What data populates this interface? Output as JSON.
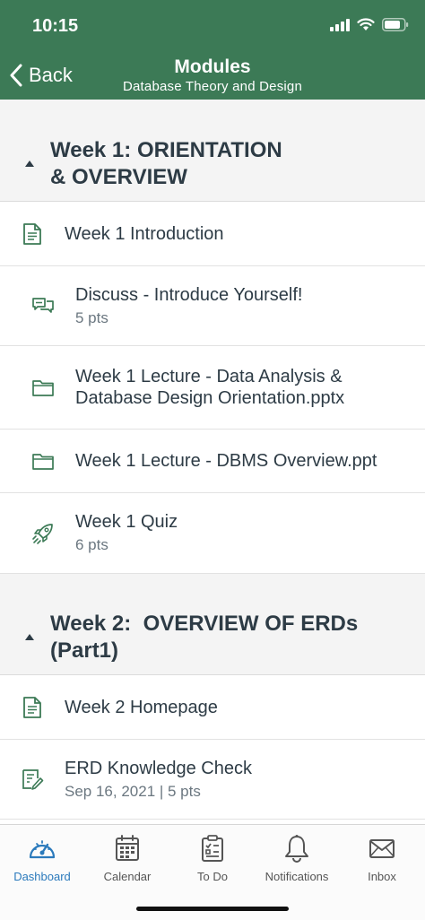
{
  "status_bar": {
    "time": "10:15"
  },
  "nav": {
    "back_label": "Back",
    "title": "Modules",
    "subtitle": "Database Theory and Design"
  },
  "modules": [
    {
      "title_line1": "Week 1: ORIENTATION",
      "title_line2": "& OVERVIEW",
      "items": [
        {
          "icon": "page-icon",
          "title": "Week 1 Introduction"
        },
        {
          "icon": "discussion-icon",
          "title": "Discuss - Introduce Yourself!",
          "meta": "5 pts"
        },
        {
          "icon": "folder-icon",
          "title_line1": "Week 1 Lecture - Data Analysis &",
          "title_line2": "Database Design Orientation.pptx"
        },
        {
          "icon": "folder-icon",
          "title": "Week 1 Lecture - DBMS Overview.ppt"
        },
        {
          "icon": "quiz-rocket-icon",
          "title": "Week 1 Quiz",
          "meta": "6 pts"
        }
      ]
    },
    {
      "title_line1": "Week 2:  OVERVIEW OF ERDs",
      "title_line2": "(Part1)",
      "items": [
        {
          "icon": "page-icon",
          "title": "Week 2 Homepage"
        },
        {
          "icon": "assignment-icon",
          "title": "ERD Knowledge Check",
          "meta": "Sep 16, 2021 | 5 pts"
        }
      ]
    }
  ],
  "tabbar": {
    "active_color": "#2b7abc",
    "tabs": [
      {
        "label": "Dashboard",
        "icon": "dashboard-icon",
        "active": true
      },
      {
        "label": "Calendar",
        "icon": "calendar-icon"
      },
      {
        "label": "To Do",
        "icon": "todo-icon"
      },
      {
        "label": "Notifications",
        "icon": "bell-icon"
      },
      {
        "label": "Inbox",
        "icon": "envelope-icon"
      }
    ]
  },
  "colors": {
    "header": "#3c7a56",
    "icon_green": "#3c7a56",
    "text": "#2d3b45"
  }
}
